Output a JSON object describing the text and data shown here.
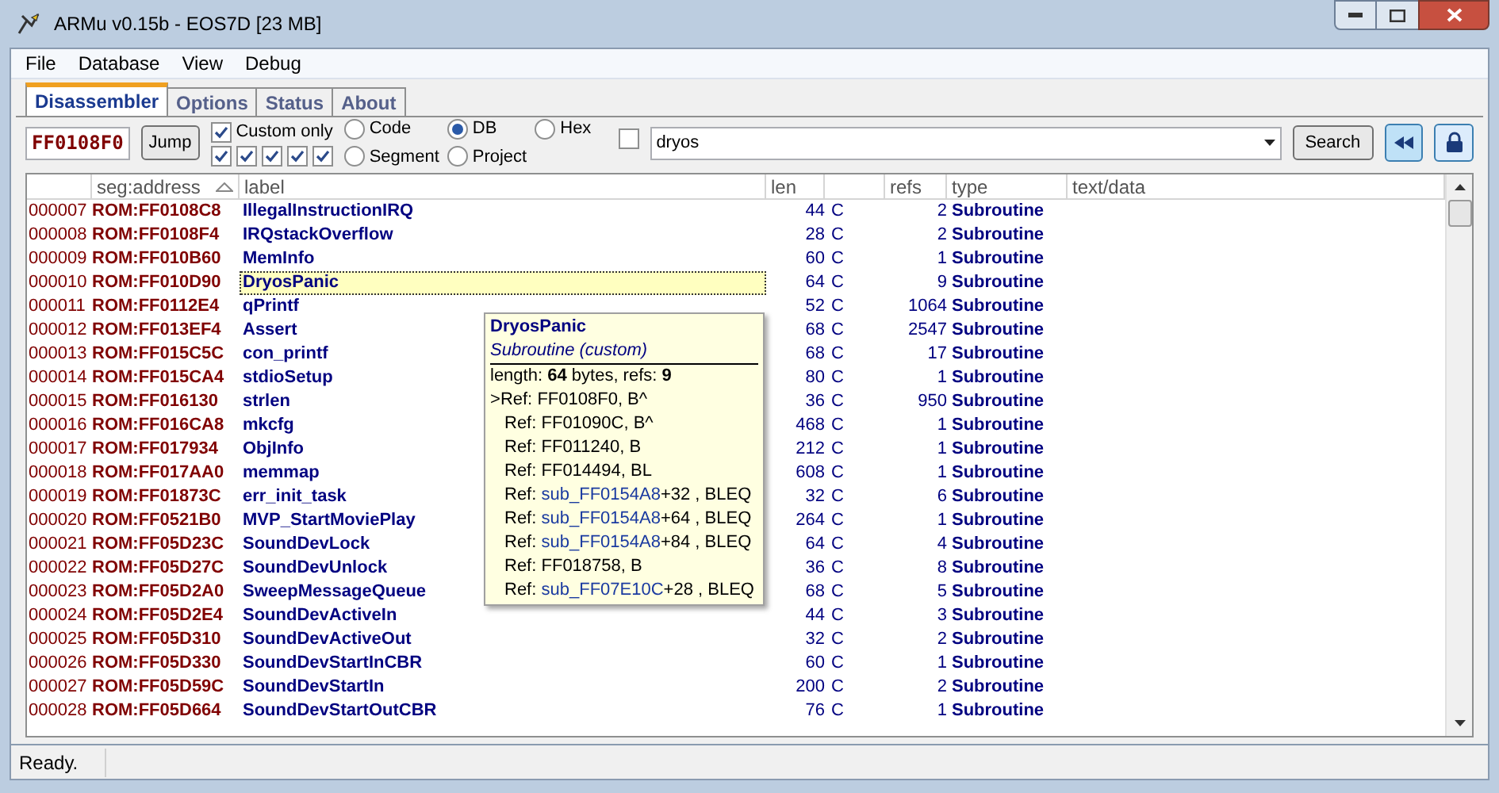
{
  "window": {
    "title": "ARMu v0.15b - EOS7D [23 MB]"
  },
  "menu": [
    "File",
    "Database",
    "View",
    "Debug"
  ],
  "tabs": [
    {
      "label": "Disassembler",
      "selected": true
    },
    {
      "label": "Options",
      "selected": false
    },
    {
      "label": "Status",
      "selected": false
    },
    {
      "label": "About",
      "selected": false
    }
  ],
  "toolbar": {
    "address": "FF0108F0",
    "jump": "Jump",
    "custom_only": {
      "label": "Custom only",
      "checked": true
    },
    "filters": [
      {
        "checked": true
      },
      {
        "checked": true
      },
      {
        "checked": true
      },
      {
        "checked": true
      },
      {
        "checked": true
      }
    ],
    "radios": [
      {
        "label": "Code",
        "selected": false
      },
      {
        "label": "DB",
        "selected": true
      },
      {
        "label": "Hex",
        "selected": false
      },
      {
        "label": "Segment",
        "selected": false
      },
      {
        "label": "Project",
        "selected": false
      }
    ],
    "search_toggle": {
      "checked": false
    },
    "search_value": "dryos",
    "search": "Search",
    "rewind_active": true
  },
  "table": {
    "columns": [
      "",
      "seg:address",
      "label",
      "len",
      "",
      "refs",
      "type",
      "text/data"
    ],
    "rows": [
      {
        "index": "000007",
        "address": "ROM:FF0108C8",
        "label": "IllegalInstructionIRQ",
        "len": "44",
        "kind": "C",
        "refs": "2",
        "type": "Subroutine",
        "selected": false
      },
      {
        "index": "000008",
        "address": "ROM:FF0108F4",
        "label": "IRQstackOverflow",
        "len": "28",
        "kind": "C",
        "refs": "2",
        "type": "Subroutine",
        "selected": false
      },
      {
        "index": "000009",
        "address": "ROM:FF010B60",
        "label": "MemInfo",
        "len": "60",
        "kind": "C",
        "refs": "1",
        "type": "Subroutine",
        "selected": false
      },
      {
        "index": "000010",
        "address": "ROM:FF010D90",
        "label": "DryosPanic",
        "len": "64",
        "kind": "C",
        "refs": "9",
        "type": "Subroutine",
        "selected": true
      },
      {
        "index": "000011",
        "address": "ROM:FF0112E4",
        "label": "qPrintf",
        "len": "52",
        "kind": "C",
        "refs": "1064",
        "type": "Subroutine",
        "selected": false
      },
      {
        "index": "000012",
        "address": "ROM:FF013EF4",
        "label": "Assert",
        "len": "68",
        "kind": "C",
        "refs": "2547",
        "type": "Subroutine",
        "selected": false
      },
      {
        "index": "000013",
        "address": "ROM:FF015C5C",
        "label": "con_printf",
        "len": "68",
        "kind": "C",
        "refs": "17",
        "type": "Subroutine",
        "selected": false
      },
      {
        "index": "000014",
        "address": "ROM:FF015CA4",
        "label": "stdioSetup",
        "len": "80",
        "kind": "C",
        "refs": "1",
        "type": "Subroutine",
        "selected": false
      },
      {
        "index": "000015",
        "address": "ROM:FF016130",
        "label": "strlen",
        "len": "36",
        "kind": "C",
        "refs": "950",
        "type": "Subroutine",
        "selected": false
      },
      {
        "index": "000016",
        "address": "ROM:FF016CA8",
        "label": "mkcfg",
        "len": "468",
        "kind": "C",
        "refs": "1",
        "type": "Subroutine",
        "selected": false
      },
      {
        "index": "000017",
        "address": "ROM:FF017934",
        "label": "ObjInfo",
        "len": "212",
        "kind": "C",
        "refs": "1",
        "type": "Subroutine",
        "selected": false
      },
      {
        "index": "000018",
        "address": "ROM:FF017AA0",
        "label": "memmap",
        "len": "608",
        "kind": "C",
        "refs": "1",
        "type": "Subroutine",
        "selected": false
      },
      {
        "index": "000019",
        "address": "ROM:FF01873C",
        "label": "err_init_task",
        "len": "32",
        "kind": "C",
        "refs": "6",
        "type": "Subroutine",
        "selected": false
      },
      {
        "index": "000020",
        "address": "ROM:FF0521B0",
        "label": "MVP_StartMoviePlay",
        "len": "264",
        "kind": "C",
        "refs": "1",
        "type": "Subroutine",
        "selected": false
      },
      {
        "index": "000021",
        "address": "ROM:FF05D23C",
        "label": "SoundDevLock",
        "len": "64",
        "kind": "C",
        "refs": "4",
        "type": "Subroutine",
        "selected": false
      },
      {
        "index": "000022",
        "address": "ROM:FF05D27C",
        "label": "SoundDevUnlock",
        "len": "36",
        "kind": "C",
        "refs": "8",
        "type": "Subroutine",
        "selected": false
      },
      {
        "index": "000023",
        "address": "ROM:FF05D2A0",
        "label": "SweepMessageQueue",
        "len": "68",
        "kind": "C",
        "refs": "5",
        "type": "Subroutine",
        "selected": false
      },
      {
        "index": "000024",
        "address": "ROM:FF05D2E4",
        "label": "SoundDevActiveIn",
        "len": "44",
        "kind": "C",
        "refs": "3",
        "type": "Subroutine",
        "selected": false
      },
      {
        "index": "000025",
        "address": "ROM:FF05D310",
        "label": "SoundDevActiveOut",
        "len": "32",
        "kind": "C",
        "refs": "2",
        "type": "Subroutine",
        "selected": false
      },
      {
        "index": "000026",
        "address": "ROM:FF05D330",
        "label": "SoundDevStartInCBR",
        "len": "60",
        "kind": "C",
        "refs": "1",
        "type": "Subroutine",
        "selected": false
      },
      {
        "index": "000027",
        "address": "ROM:FF05D59C",
        "label": "SoundDevStartIn",
        "len": "200",
        "kind": "C",
        "refs": "2",
        "type": "Subroutine",
        "selected": false
      },
      {
        "index": "000028",
        "address": "ROM:FF05D664",
        "label": "SoundDevStartOutCBR",
        "len": "76",
        "kind": "C",
        "refs": "1",
        "type": "Subroutine",
        "selected": false
      }
    ]
  },
  "tooltip": {
    "title": "DryosPanic",
    "subtitle": "Subroutine (custom)",
    "summary": "length: **64** bytes, refs: **9**",
    "refs": [
      {
        "marker": ">",
        "label": "Ref:",
        "target": "FF0108F0",
        "rest": ", B^",
        "linked": false
      },
      {
        "label": "Ref:",
        "target": "FF01090C",
        "rest": ", B^",
        "linked": false
      },
      {
        "label": "Ref:",
        "target": "FF011240",
        "rest": ", B",
        "linked": false
      },
      {
        "label": "Ref:",
        "target": "FF014494",
        "rest": ", BL",
        "linked": false
      },
      {
        "label": "Ref:",
        "target": "sub_FF0154A8",
        "rest": "+32 , BLEQ",
        "linked": true
      },
      {
        "label": "Ref:",
        "target": "sub_FF0154A8",
        "rest": "+64 , BLEQ",
        "linked": true
      },
      {
        "label": "Ref:",
        "target": "sub_FF0154A8",
        "rest": "+84 , BLEQ",
        "linked": true
      },
      {
        "label": "Ref:",
        "target": "FF018758",
        "rest": ", B",
        "linked": false
      },
      {
        "label": "Ref:",
        "target": "sub_FF07E10C",
        "rest": "+28 , BLEQ",
        "linked": true
      }
    ]
  },
  "status_bar": "Ready."
}
